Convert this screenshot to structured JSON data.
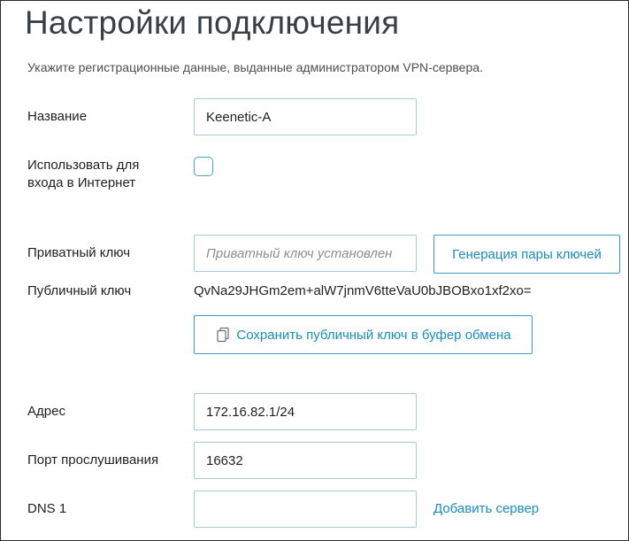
{
  "page": {
    "title": "Настройки подключения",
    "subtitle": "Укажите регистрационные данные, выданные администратором VPN-сервера."
  },
  "form": {
    "name": {
      "label": "Название",
      "value": "Keenetic-A"
    },
    "internet": {
      "label_line1": "Использовать для",
      "label_line2": "входа в Интернет",
      "checked": false
    },
    "private_key": {
      "label": "Приватный ключ",
      "placeholder": "Приватный ключ установлен",
      "value": ""
    },
    "generate_button": "Генерация пары ключей",
    "public_key": {
      "label": "Публичный ключ",
      "value": "QvNa29JHGm2em+alW7jnmV6tteVaU0bJBOBxo1xf2xo="
    },
    "copy_button": "Сохранить публичный ключ в буфер обмена",
    "address": {
      "label": "Адрес",
      "value": "172.16.82.1/24"
    },
    "port": {
      "label": "Порт прослушивания",
      "value": "16632"
    },
    "dns1": {
      "label": "DNS 1",
      "value": ""
    },
    "add_server_link": "Добавить сервер"
  },
  "icons": {
    "copy": "copy-icon"
  },
  "colors": {
    "accent": "#1a8cc0",
    "input_border": "#a9cbd9",
    "title": "#3a3f46"
  }
}
